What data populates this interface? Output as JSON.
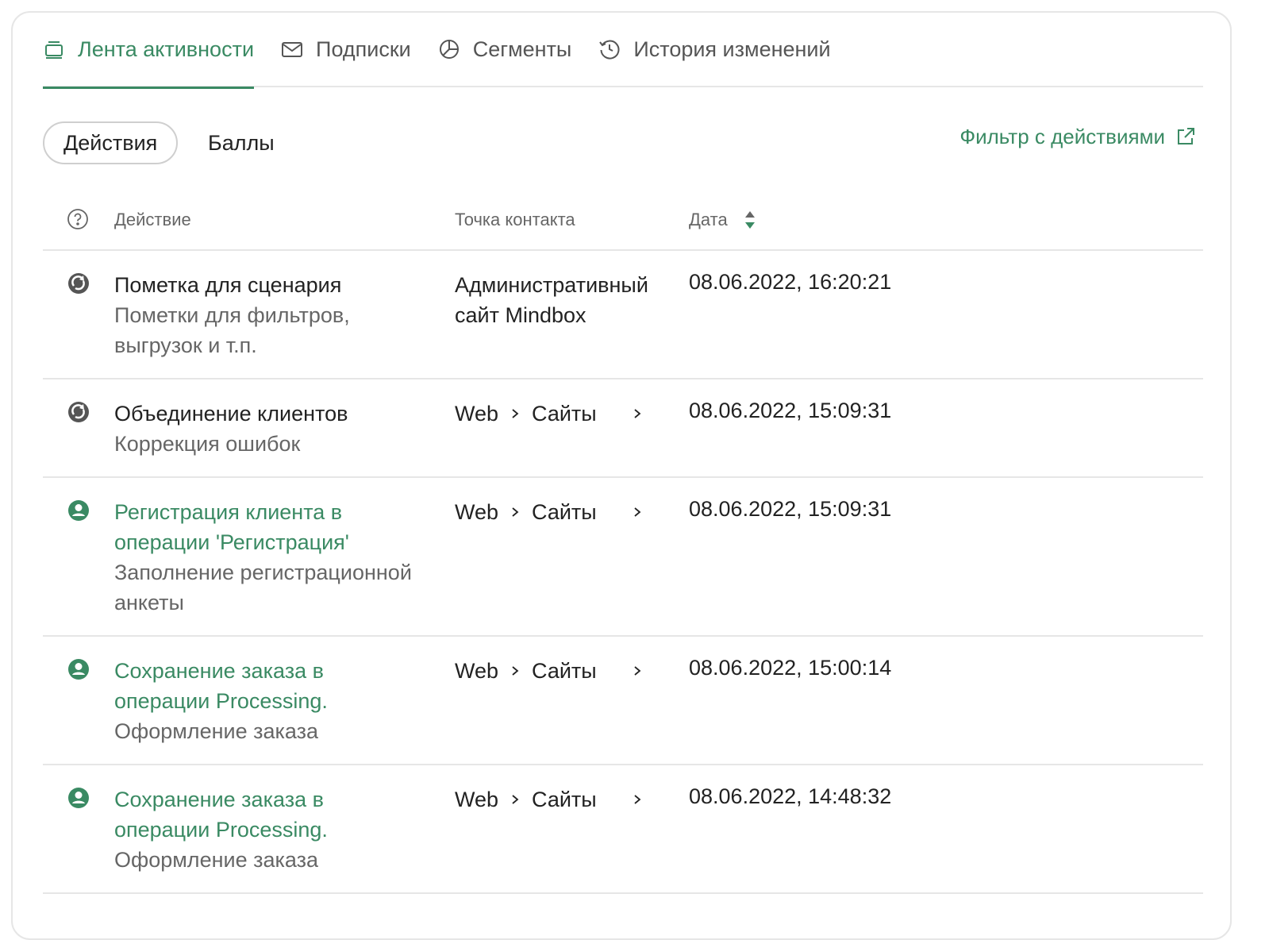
{
  "tabs": [
    {
      "label": "Лента активности",
      "icon": "feed-icon",
      "active": true
    },
    {
      "label": "Подписки",
      "icon": "mail-icon",
      "active": false
    },
    {
      "label": "Сегменты",
      "icon": "pie-chart-icon",
      "active": false
    },
    {
      "label": "История изменений",
      "icon": "history-icon",
      "active": false
    }
  ],
  "subtabs": {
    "actions": "Действия",
    "points": "Баллы"
  },
  "filter_link": "Фильтр с действиями",
  "table": {
    "headers": {
      "action": "Действие",
      "contact": "Точка контакта",
      "date": "Дата"
    },
    "rows": [
      {
        "icon": "system-icon",
        "title": "Пометка для сценария",
        "title_line2": "",
        "subtitle": "Пометки для фильтров,",
        "subtitle_line2": "выгрузок и т.п.",
        "contact_line1": "Административный",
        "contact_line2": "сайт Mindbox",
        "date": "08.06.2022, 16:20:21"
      },
      {
        "icon": "system-icon",
        "title": "Объединение клиентов",
        "subtitle": "Коррекция ошибок",
        "crumb_a": "Web",
        "crumb_b": "Сайты",
        "date": "08.06.2022, 15:09:31"
      },
      {
        "icon": "user-icon",
        "title": "Регистрация клиента в",
        "title_line2": "операции 'Регистрация'",
        "subtitle": "Заполнение регистрационной",
        "subtitle_line2": "анкеты",
        "crumb_a": "Web",
        "crumb_b": "Сайты",
        "date": "08.06.2022, 15:09:31"
      },
      {
        "icon": "user-icon",
        "title": "Сохранение заказа в",
        "title_line2": "операции Processing.",
        "subtitle": "Оформление заказа",
        "crumb_a": "Web",
        "crumb_b": "Сайты",
        "date": "08.06.2022, 15:00:14"
      },
      {
        "icon": "user-icon",
        "title": "Сохранение заказа в",
        "title_line2": "операции Processing.",
        "subtitle": "Оформление заказа",
        "crumb_a": "Web",
        "crumb_b": "Сайты",
        "date": "08.06.2022, 14:48:32"
      }
    ]
  },
  "colors": {
    "accent": "#3a8a63",
    "muted": "#666666",
    "border": "#e6e6e6"
  }
}
